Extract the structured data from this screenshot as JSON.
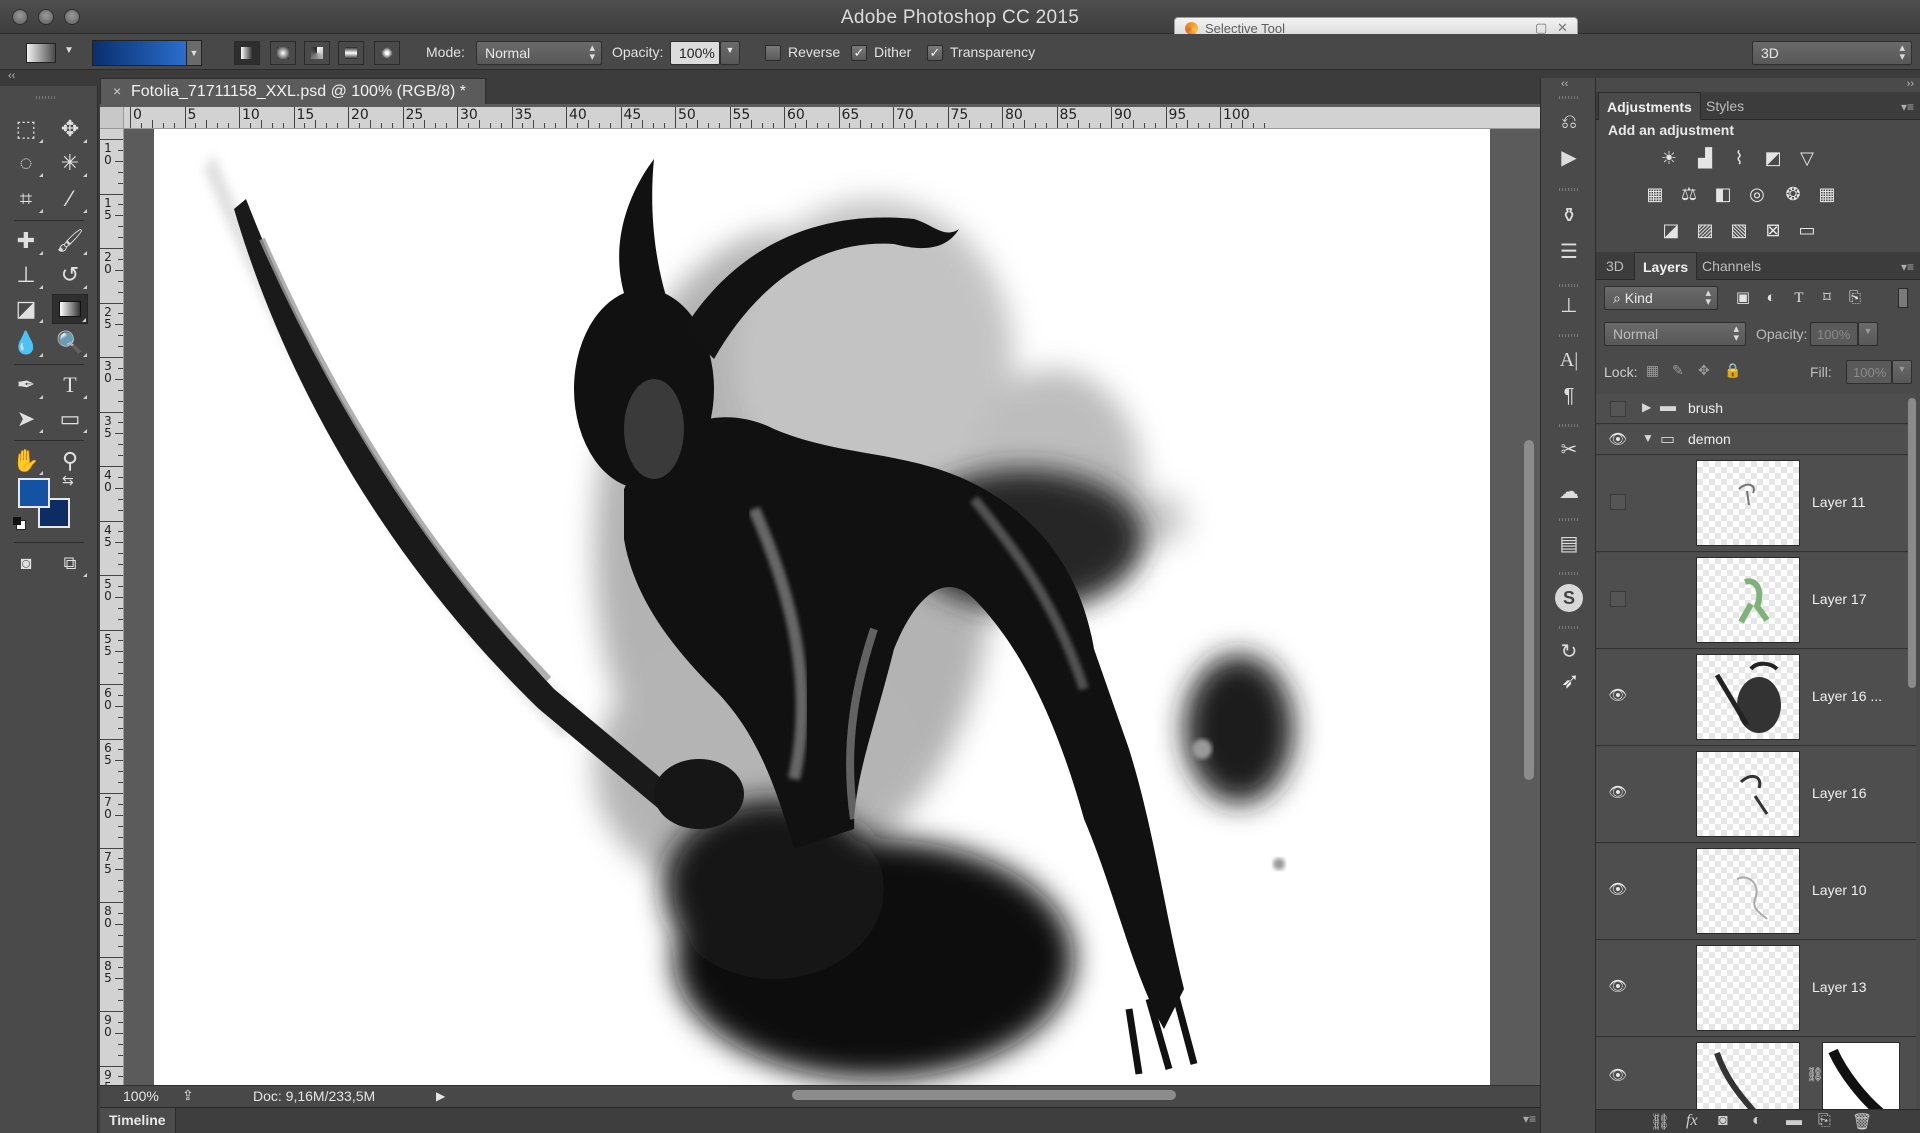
{
  "window": {
    "title": "Adobe Photoshop CC 2015",
    "floating_panel": {
      "title": "Selective Tool"
    }
  },
  "options_bar": {
    "mode_label": "Mode:",
    "mode_value": "Normal",
    "opacity_label": "Opacity:",
    "opacity_value": "100%",
    "reverse_label": "Reverse",
    "reverse_checked": false,
    "dither_label": "Dither",
    "dither_checked": true,
    "transparency_label": "Transparency",
    "transparency_checked": true,
    "workspace_value": "3D",
    "gradient_colors": [
      "#0a2f6e",
      "#2b6fd0"
    ]
  },
  "tools": {
    "foreground_color": "#1452a3",
    "background_color": "#0c2c63"
  },
  "document": {
    "tab_title": "Fotolia_71711158_XXL.psd @ 100% (RGB/8) *",
    "close_glyph": "×",
    "ruler_top": [
      "0",
      "5",
      "10",
      "15",
      "20",
      "25",
      "30",
      "35",
      "40",
      "45",
      "50",
      "55",
      "60",
      "65",
      "70",
      "75",
      "80",
      "85",
      "90",
      "95",
      "100"
    ],
    "ruler_left": [
      "10",
      "15",
      "20",
      "25",
      "30",
      "35",
      "40",
      "45",
      "50",
      "55",
      "60",
      "65",
      "70",
      "75",
      "80",
      "85",
      "90",
      "95"
    ]
  },
  "status": {
    "zoom": "100%",
    "doc_info": "Doc: 9,16M/233,5M"
  },
  "timeline": {
    "label": "Timeline"
  },
  "adjustments_panel": {
    "tabs": [
      "Adjustments",
      "Styles"
    ],
    "heading": "Add an adjustment"
  },
  "layers_panel": {
    "tabs": [
      "3D",
      "Layers",
      "Channels"
    ],
    "filter_value": "Kind",
    "blend_mode": "Normal",
    "opacity_label": "Opacity:",
    "opacity_value": "100%",
    "lock_label": "Lock:",
    "fill_label": "Fill:",
    "fill_value": "100%",
    "groups": [
      {
        "name": "brush",
        "visible": false,
        "expanded": false
      },
      {
        "name": "demon",
        "visible": true,
        "expanded": true
      }
    ],
    "layers": [
      {
        "name": "Layer 11",
        "visible": false
      },
      {
        "name": "Layer 17",
        "visible": false
      },
      {
        "name": "Layer 16 ...",
        "visible": true
      },
      {
        "name": "Layer 16",
        "visible": true
      },
      {
        "name": "Layer 10",
        "visible": true
      },
      {
        "name": "Layer 13",
        "visible": true
      },
      {
        "name": "",
        "visible": true
      }
    ]
  }
}
